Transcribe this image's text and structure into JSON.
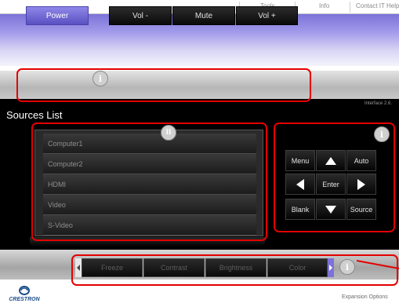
{
  "top_links": [
    "Tools",
    "Info",
    "Contact IT Help"
  ],
  "control_bar": {
    "power": "Power",
    "vol_down": "Vol -",
    "mute": "Mute",
    "vol_up": "Vol +"
  },
  "interface_version": "Interface 2.6.",
  "sources": {
    "title": "Sources List",
    "items": [
      "Computer1",
      "Computer2",
      "HDMI",
      "Video",
      "S-Video"
    ]
  },
  "keypad": {
    "menu": "Menu",
    "auto": "Auto",
    "enter": "Enter",
    "blank": "Blank",
    "source": "Source"
  },
  "adjust": [
    "Freeze",
    "Contrast",
    "Brightness",
    "Color"
  ],
  "footer": {
    "logo": "CRESTRON",
    "expansion": "Expansion Options"
  },
  "annotations": {
    "info_i": "i",
    "info_ii": "ii"
  },
  "colors": {
    "annotation": "#e40000",
    "power_active": "#6b62d2",
    "banner": "#7c72d8"
  }
}
